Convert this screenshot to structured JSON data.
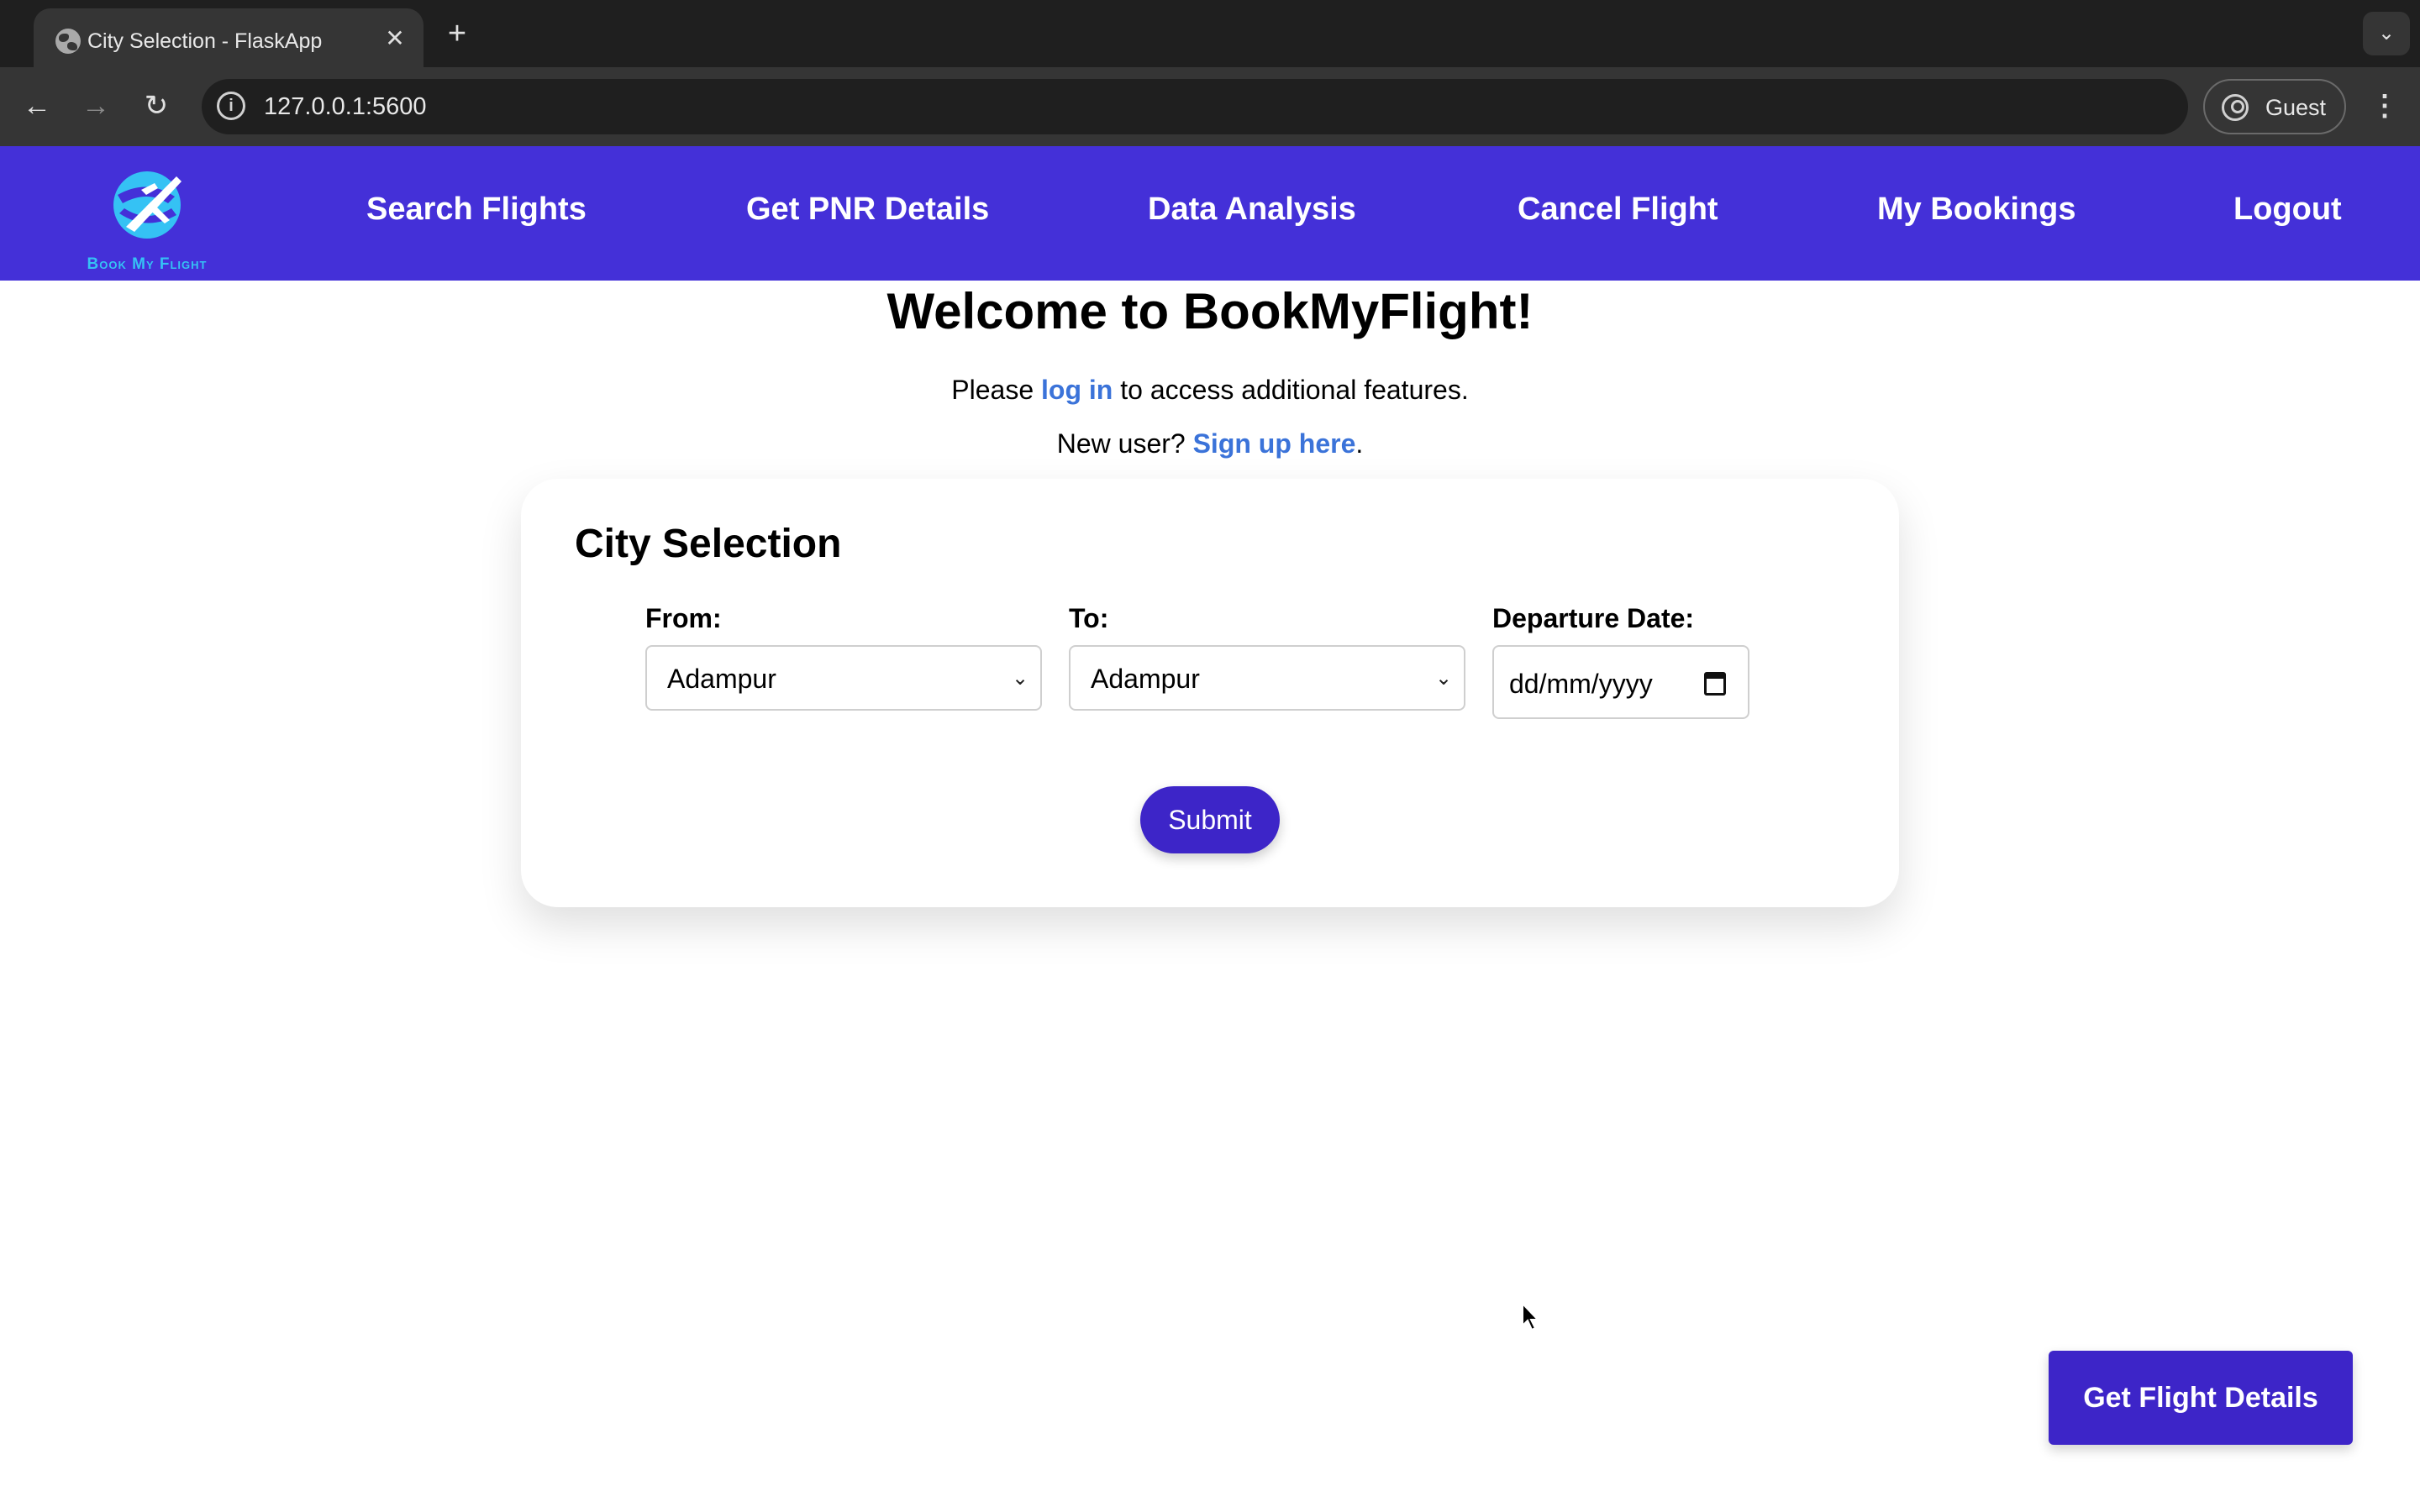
{
  "browser": {
    "tab_title": "City Selection - FlaskApp",
    "url": "127.0.0.1:5600",
    "profile_label": "Guest"
  },
  "navbar": {
    "logo_text": "Book My Flight",
    "links": [
      {
        "label": "Search Flights"
      },
      {
        "label": "Get PNR Details"
      },
      {
        "label": "Data Analysis"
      },
      {
        "label": "Cancel Flight"
      },
      {
        "label": "My Bookings"
      },
      {
        "label": "Logout"
      }
    ]
  },
  "welcome": {
    "title": "Welcome to BookMyFlight!",
    "login_prefix": "Please",
    "login_link": "log in",
    "login_suffix": "to access additional features.",
    "signup_prefix": "New user?",
    "signup_link": "Sign up here",
    "signup_suffix": "."
  },
  "form": {
    "title": "City Selection",
    "from_label": "From:",
    "from_value": "Adampur",
    "to_label": "To:",
    "to_value": "Adampur",
    "date_label": "Departure Date:",
    "date_placeholder": "dd/mm/yyyy",
    "submit_label": "Submit"
  },
  "floating_button": {
    "label": "Get Flight Details"
  },
  "colors": {
    "navbar": "#4430d8",
    "primary_button": "#3d25c8",
    "link": "#3b73d9",
    "logo": "#35c2f4"
  }
}
